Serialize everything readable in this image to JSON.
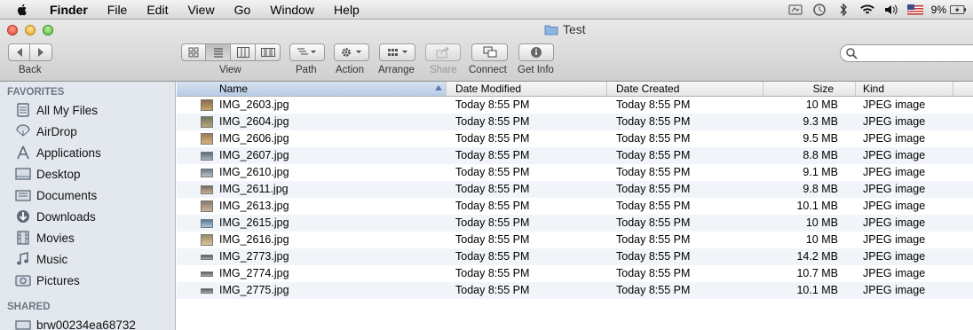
{
  "menubar": {
    "app_name": "Finder",
    "items": [
      "File",
      "Edit",
      "View",
      "Go",
      "Window",
      "Help"
    ],
    "battery_percent": "9%"
  },
  "window": {
    "title": "Test"
  },
  "toolbar": {
    "back_label": "Back",
    "view_label": "View",
    "path_label": "Path",
    "action_label": "Action",
    "arrange_label": "Arrange",
    "share_label": "Share",
    "connect_label": "Connect",
    "get_info_label": "Get Info"
  },
  "sidebar": {
    "favorites_heading": "FAVORITES",
    "favorites": [
      {
        "label": "All My Files",
        "icon": "all-files-icon"
      },
      {
        "label": "AirDrop",
        "icon": "airdrop-icon"
      },
      {
        "label": "Applications",
        "icon": "applications-icon"
      },
      {
        "label": "Desktop",
        "icon": "desktop-icon"
      },
      {
        "label": "Documents",
        "icon": "documents-icon"
      },
      {
        "label": "Downloads",
        "icon": "downloads-icon"
      },
      {
        "label": "Movies",
        "icon": "movies-icon"
      },
      {
        "label": "Music",
        "icon": "music-icon"
      },
      {
        "label": "Pictures",
        "icon": "pictures-icon"
      }
    ],
    "shared_heading": "SHARED",
    "shared": [
      {
        "label": "brw00234ea68732",
        "icon": "printer-icon"
      }
    ]
  },
  "list": {
    "columns": {
      "name": "Name",
      "modified": "Date Modified",
      "created": "Date Created",
      "size": "Size",
      "kind": "Kind"
    },
    "files": [
      {
        "name": "IMG_2603.jpg",
        "modified": "Today 8:55 PM",
        "created": "Today 8:55 PM",
        "size": "10 MB",
        "kind": "JPEG image"
      },
      {
        "name": "IMG_2604.jpg",
        "modified": "Today 8:55 PM",
        "created": "Today 8:55 PM",
        "size": "9.3 MB",
        "kind": "JPEG image"
      },
      {
        "name": "IMG_2606.jpg",
        "modified": "Today 8:55 PM",
        "created": "Today 8:55 PM",
        "size": "9.5 MB",
        "kind": "JPEG image"
      },
      {
        "name": "IMG_2607.jpg",
        "modified": "Today 8:55 PM",
        "created": "Today 8:55 PM",
        "size": "8.8 MB",
        "kind": "JPEG image"
      },
      {
        "name": "IMG_2610.jpg",
        "modified": "Today 8:55 PM",
        "created": "Today 8:55 PM",
        "size": "9.1 MB",
        "kind": "JPEG image"
      },
      {
        "name": "IMG_2611.jpg",
        "modified": "Today 8:55 PM",
        "created": "Today 8:55 PM",
        "size": "9.8 MB",
        "kind": "JPEG image"
      },
      {
        "name": "IMG_2613.jpg",
        "modified": "Today 8:55 PM",
        "created": "Today 8:55 PM",
        "size": "10.1 MB",
        "kind": "JPEG image"
      },
      {
        "name": "IMG_2615.jpg",
        "modified": "Today 8:55 PM",
        "created": "Today 8:55 PM",
        "size": "10 MB",
        "kind": "JPEG image"
      },
      {
        "name": "IMG_2616.jpg",
        "modified": "Today 8:55 PM",
        "created": "Today 8:55 PM",
        "size": "10 MB",
        "kind": "JPEG image"
      },
      {
        "name": "IMG_2773.jpg",
        "modified": "Today 8:55 PM",
        "created": "Today 8:55 PM",
        "size": "14.2 MB",
        "kind": "JPEG image"
      },
      {
        "name": "IMG_2774.jpg",
        "modified": "Today 8:55 PM",
        "created": "Today 8:55 PM",
        "size": "10.7 MB",
        "kind": "JPEG image"
      },
      {
        "name": "IMG_2775.jpg",
        "modified": "Today 8:55 PM",
        "created": "Today 8:55 PM",
        "size": "10.1 MB",
        "kind": "JPEG image"
      }
    ]
  }
}
